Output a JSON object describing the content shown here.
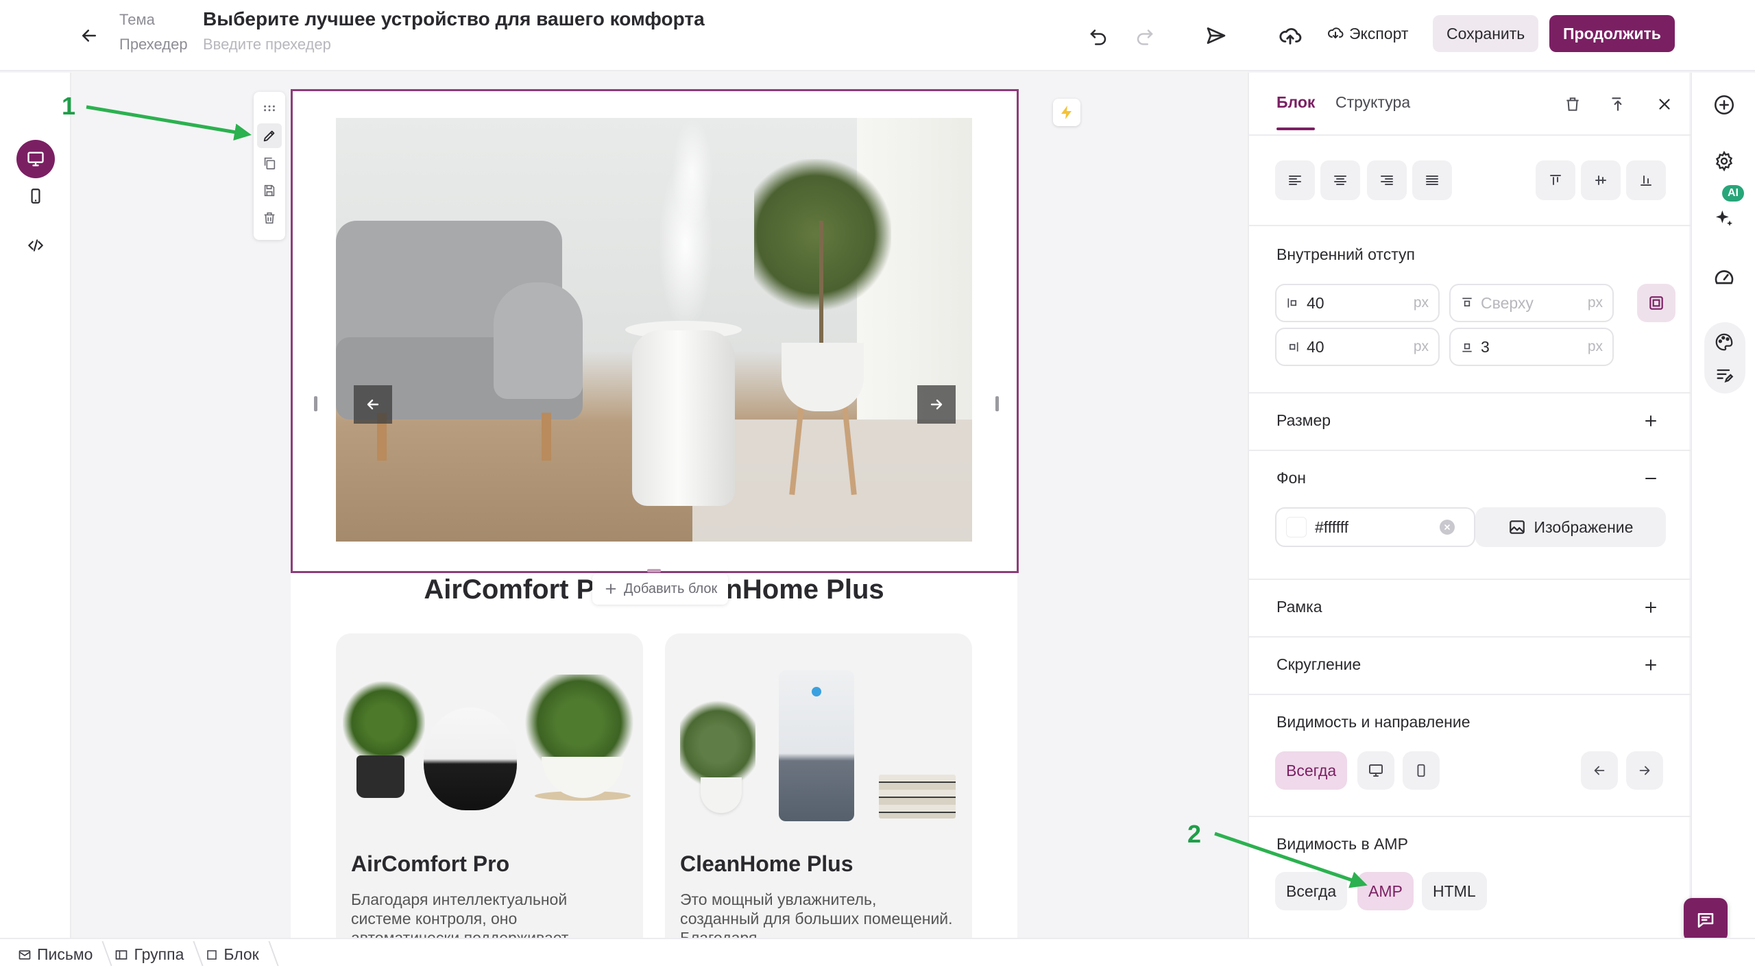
{
  "header": {
    "theme_label": "Тема",
    "subject": "Выберите лучшее устройство для вашего комфорта",
    "preheader_label": "Прехедер",
    "preheader_placeholder": "Введите прехедер",
    "export_label": "Экспорт",
    "save_label": "Сохранить",
    "continue_label": "Продолжить",
    "accent_color": "#7b1f63"
  },
  "canvas": {
    "section_title": "AirComfort Pro vs CleanHome Plus",
    "add_block_label": "Добавить блок",
    "products": [
      {
        "title": "AirComfort Pro",
        "description": "Благодаря интеллектуальной системе контроля, оно автоматически поддерживает"
      },
      {
        "title": "CleanHome Plus",
        "description": "Это мощный увлажнитель, созданный для больших помещений. Благодаря"
      }
    ]
  },
  "panel": {
    "tabs": [
      "Блок",
      "Структура"
    ],
    "padding_label": "Внутренний отступ",
    "padding": {
      "left": "40",
      "top_placeholder": "Сверху",
      "right": "40",
      "bottom": "3",
      "unit": "px"
    },
    "size_label": "Размер",
    "background_label": "Фон",
    "background_color": "#ffffff",
    "image_label": "Изображение",
    "border_label": "Рамка",
    "radius_label": "Скругление",
    "visibility_label": "Видимость и направление",
    "visibility_always": "Всегда",
    "amp_label": "Видимость в AMP",
    "amp_options": [
      "Всегда",
      "AMP",
      "HTML"
    ],
    "amp_selected": "AMP"
  },
  "right_rail": {
    "ai_badge": "AI"
  },
  "breadcrumb": [
    "Письмо",
    "Группа",
    "Блок"
  ],
  "annotations": {
    "step1": "1",
    "step2": "2",
    "arrow_color": "#2bb14f"
  }
}
